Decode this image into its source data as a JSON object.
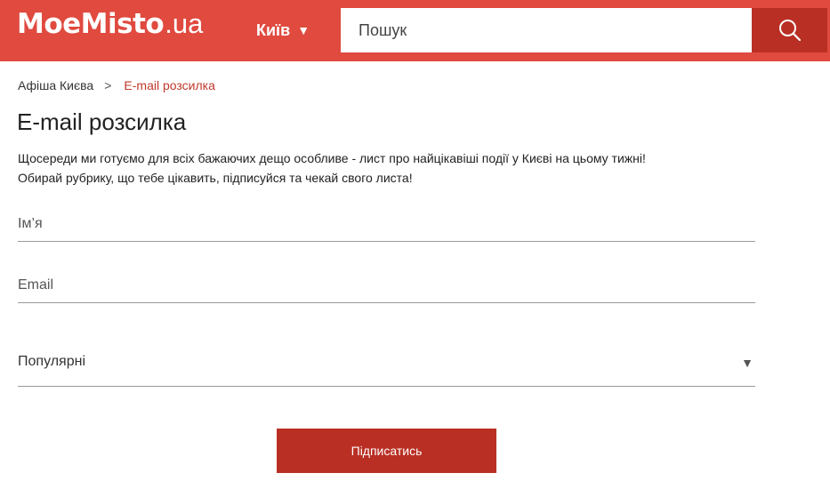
{
  "header": {
    "logo_main": "MoeMisto",
    "logo_tld": ".ua",
    "city": "Київ",
    "search_placeholder": "Пошук",
    "background_color": "#e04a3f",
    "accent_color": "#b92f24"
  },
  "breadcrumb": {
    "items": [
      "Афіша Києва",
      "E-mail розсилка"
    ],
    "separator": ">"
  },
  "page": {
    "title": "E-mail розсилка",
    "intro_lines": [
      "Щосереди ми готуємо для всіх бажаючих дещо особливе - лист про найцікавіші події у Києві на цьому тижні!",
      "Обирай рубрику, що тебе цікавить, підписуйся та чекай свого листа!"
    ]
  },
  "form": {
    "name_placeholder": "Ім’я",
    "email_placeholder": "Email",
    "category_selected": "Популярні",
    "submit_label": "Підписатись"
  },
  "icons": {
    "city_caret": "chevron-down-icon",
    "search": "search-icon",
    "select_caret": "chevron-down-icon"
  }
}
